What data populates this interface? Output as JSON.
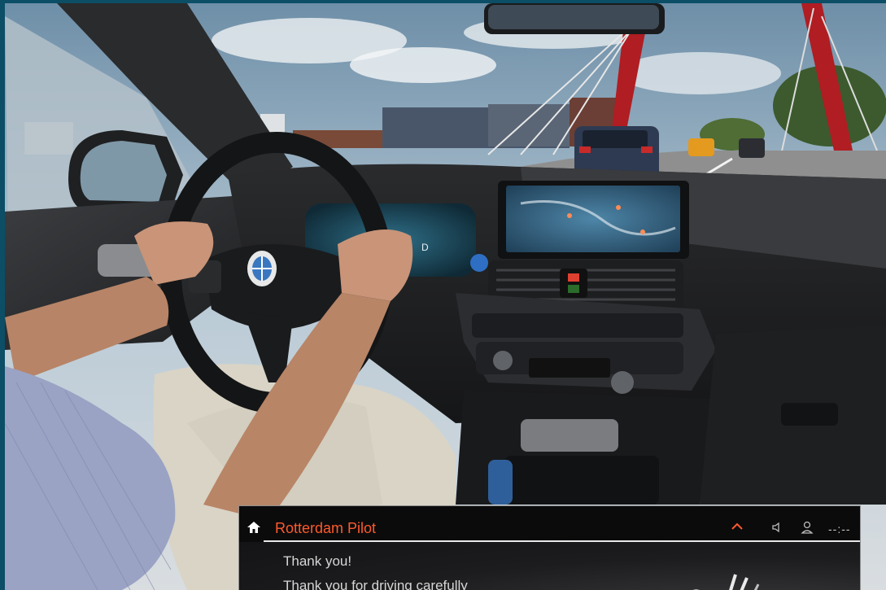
{
  "panel": {
    "title": "Rotterdam Pilot",
    "clock": "--:--",
    "line1": "Thank you!",
    "line2": "Thank you for driving carefully"
  },
  "icons": {
    "home": "home-icon",
    "expand": "chevron-up-icon",
    "speaker": "speaker-icon",
    "profile": "user-icon"
  },
  "colors": {
    "accent": "#ff5a2c",
    "panel_bg": "#0b0b0c",
    "frame": "#0b4e66"
  }
}
